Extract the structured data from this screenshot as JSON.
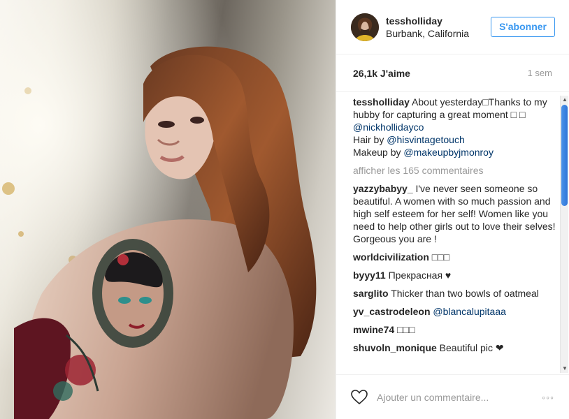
{
  "header": {
    "username": "tessholliday",
    "location": "Burbank, California",
    "follow_label": "S'abonner"
  },
  "stats": {
    "likes": "26,1k J'aime",
    "time": "1 sem"
  },
  "caption": {
    "author": "tessholliday",
    "line1": " About yesterday□Thanks to my hubby for capturing a great moment □ □ ",
    "mention1": "@nickhollidayco",
    "hair_prefix": "Hair by ",
    "mention2": "@hisvintagetouch",
    "makeup_prefix": "Makeup by ",
    "mention3": "@makeupbyjmonroy"
  },
  "view_all": "afficher les 165 commentaires",
  "comments": [
    {
      "author": "yazzybabyy_",
      "text": " I've never seen someone so beautiful. A women with so much passion and high self esteem for her self! Women like you need to help other girls out to love their selves! Gorgeous you are !"
    },
    {
      "author": "worldcivilization",
      "text": " □□□"
    },
    {
      "author": "byyy11",
      "text": " Прекрасная ♥"
    },
    {
      "author": "sarglito",
      "text": " Thicker than two bowls of oatmeal"
    },
    {
      "author": "yv_castrodeleon",
      "link": "@blancalupitaaa"
    },
    {
      "author": "mwine74",
      "text": " □□□"
    },
    {
      "author": "shuvoln_monique",
      "text": " Beautiful pic ❤"
    }
  ],
  "footer": {
    "placeholder": "Ajouter un commentaire...",
    "more": "◦◦◦"
  },
  "icons": {
    "heart": "heart-icon",
    "more": "more-options-icon",
    "scroll_up": "scroll-up-arrow-icon",
    "scroll_down": "scroll-down-arrow-icon"
  },
  "colors": {
    "link": "#003569",
    "accent": "#3897f0",
    "muted": "#999999",
    "text": "#262626"
  }
}
